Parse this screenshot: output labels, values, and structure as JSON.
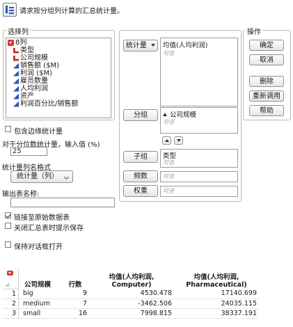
{
  "header": {
    "instruction": "请求按分组列计算的汇总统计量。"
  },
  "select_columns": {
    "legend": "选择列",
    "count_label": "8列",
    "items": [
      {
        "label": "类型",
        "kind": "nominal"
      },
      {
        "label": "公司规模",
        "kind": "nominal"
      },
      {
        "label": "销售额 ($M)",
        "kind": "continuous"
      },
      {
        "label": "利润 ($M)",
        "kind": "continuous"
      },
      {
        "label": "雇员数量",
        "kind": "continuous"
      },
      {
        "label": "人均利润",
        "kind": "continuous"
      },
      {
        "label": "资产",
        "kind": "continuous"
      },
      {
        "label": "利润百分比/销售额",
        "kind": "continuous"
      }
    ]
  },
  "roles": {
    "stat_button": "统计量",
    "stat_item": "均值(人均利润)",
    "optional": "可选",
    "group_button": "分组",
    "group_item": "公司规模",
    "subgroup_button": "子组",
    "subgroup_item": "类型",
    "freq_button": "频数",
    "weight_button": "权重"
  },
  "actions": {
    "legend": "操作",
    "ok": "确定",
    "cancel": "取消",
    "remove": "删除",
    "recall": "重新调用",
    "help": "帮助"
  },
  "options": {
    "include_marginal": "包含边缘统计量",
    "quantile_label": "对于分位数统计量，输入值 (%)",
    "quantile_value": "25",
    "name_format_label": "统计量列名格式",
    "name_format_value": "统计量（列）",
    "output_table_label": "输出表名称:",
    "output_table_value": "",
    "link_source": "链接至原始数据表",
    "close_prompt_save": "关闭汇总表时提示保存",
    "keep_dialog_open": "保持对话框打开"
  },
  "result_table": {
    "columns": [
      "公司规模",
      "行数",
      "均值(人均利润, Computer)",
      "均值(人均利润, Pharmaceutical)"
    ],
    "col2_line1": "均值(人均利润,",
    "col2_line2": "Computer)",
    "col3_line1": "均值(人均利润,",
    "col3_line2": "Pharmaceutical)",
    "rows": [
      {
        "n": "1",
        "size": "big",
        "count": "9",
        "computer": "4530.478",
        "pharma": "17140.699"
      },
      {
        "n": "2",
        "size": "medium",
        "count": "7",
        "computer": "-3462.506",
        "pharma": "24035.115"
      },
      {
        "n": "3",
        "size": "small",
        "count": "16",
        "computer": "7998.815",
        "pharma": "38337.191"
      }
    ]
  }
}
